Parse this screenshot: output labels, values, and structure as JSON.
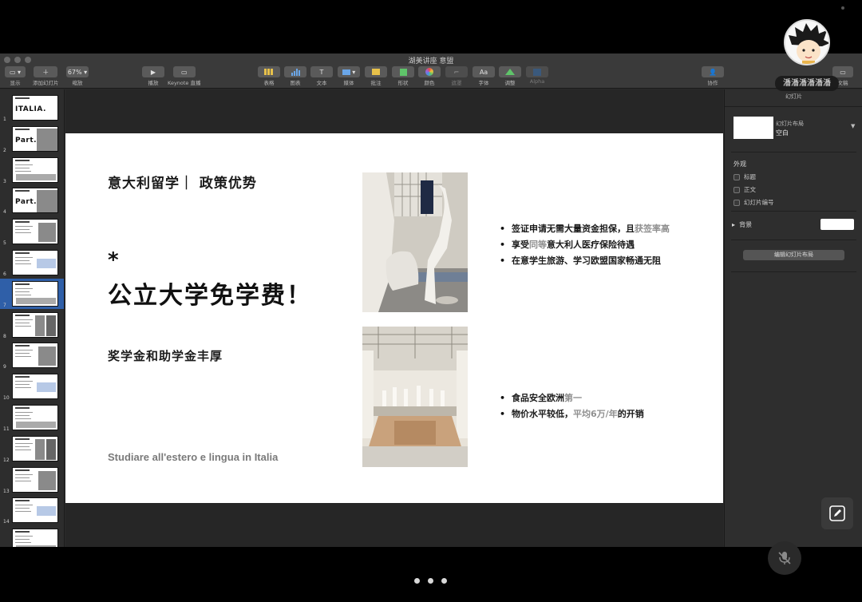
{
  "window": {
    "title": "湖美讲座 意盟",
    "toolbar": {
      "view": "显示",
      "add_slide": "添加幻灯片",
      "zoom_value": "67%",
      "zoom_label": "缩放",
      "play": "播放",
      "keynote_live": "Keynote 直播",
      "table": "表格",
      "chart": "图表",
      "text": "文本",
      "media": "媒体",
      "comment": "批注",
      "shape": "形状",
      "color": "颜色",
      "mask": "遮罩",
      "font": "字体",
      "adjust": "调整",
      "alpha": "Alpha",
      "collaborate": "协作",
      "document": "文稿"
    }
  },
  "navigator": {
    "slides": [
      {
        "num": "1",
        "big": "ITALIA."
      },
      {
        "num": "2",
        "big": "Part.01"
      },
      {
        "num": "3",
        "big": ""
      },
      {
        "num": "4",
        "big": "Part.02"
      },
      {
        "num": "5",
        "big": ""
      },
      {
        "num": "6",
        "big": ""
      },
      {
        "num": "7",
        "big": ""
      },
      {
        "num": "8",
        "big": ""
      },
      {
        "num": "9",
        "big": ""
      },
      {
        "num": "10",
        "big": ""
      },
      {
        "num": "11",
        "big": ""
      },
      {
        "num": "12",
        "big": ""
      },
      {
        "num": "13",
        "big": ""
      },
      {
        "num": "14",
        "big": ""
      },
      {
        "num": "",
        "big": ""
      }
    ],
    "selected_num": "7"
  },
  "slide": {
    "heading": "意大利留学｜ 政策优势",
    "star": "*",
    "main_text": "公立大学免学费！",
    "sub_text": "奖学金和助学金丰厚",
    "footer": "Studiare all'estero e lingua in Italia",
    "bullets_top": [
      {
        "pre": "签证申请无需大量资金担保，且",
        "muted": "获签率高",
        "post": ""
      },
      {
        "pre": "享受",
        "muted": "同等",
        "post": "意大利人医疗保险待遇"
      },
      {
        "pre": "在意学生旅游、学习欧盟国家畅通无阻",
        "muted": "",
        "post": ""
      }
    ],
    "bullets_bottom": [
      {
        "pre": "食品安全欧洲",
        "muted": "第一",
        "post": ""
      },
      {
        "pre": "物价水平较低，",
        "muted": "平均6万/年",
        "post": "的开销"
      }
    ]
  },
  "inspector": {
    "tab_label": "幻灯片",
    "layout_label": "幻灯片布局",
    "layout_value": "空白",
    "appearance": "外观",
    "check_title": "标题",
    "check_body": "正文",
    "check_number": "幻灯片编号",
    "background": "背景",
    "edit_layout": "编辑幻灯片布局"
  },
  "meeting": {
    "participant_name": "潘潘潘潘潘潘",
    "pages": 3
  }
}
